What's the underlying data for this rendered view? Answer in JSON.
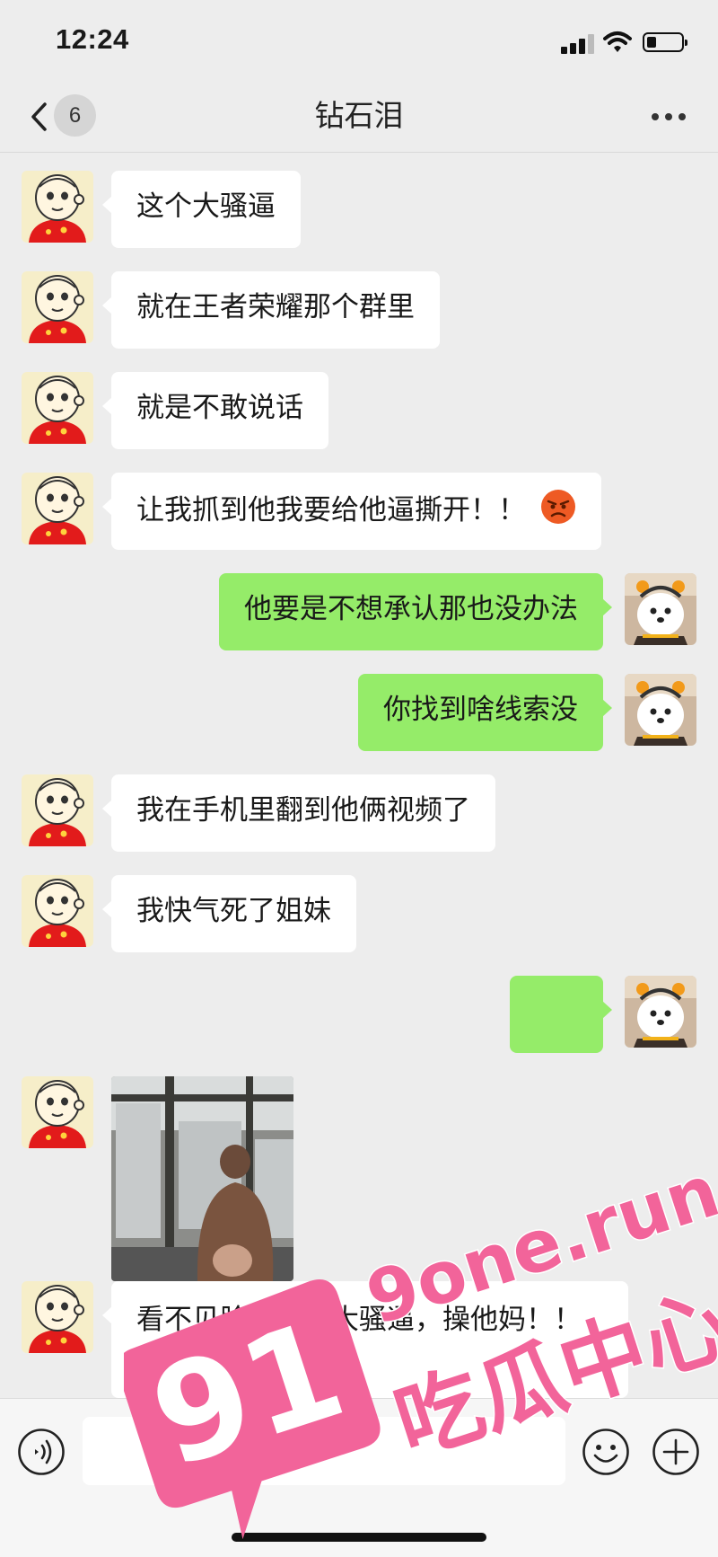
{
  "status_bar": {
    "time": "12:24",
    "icons": [
      "signal-icon",
      "wifi-icon",
      "battery-icon"
    ]
  },
  "nav": {
    "back_icon": "chevron-left-icon",
    "unread_count": "6",
    "title": "钻石泪",
    "more_icon": "more-dots-icon"
  },
  "messages": [
    {
      "side": "in",
      "text": "这个大骚逼"
    },
    {
      "side": "in",
      "text": "就在王者荣耀那个群里"
    },
    {
      "side": "in",
      "text": "就是不敢说话"
    },
    {
      "side": "in",
      "text": "让我抓到他我要给他逼撕开！！",
      "emoji": "angry-face-emoji"
    },
    {
      "side": "out",
      "text": "他要是不想承认那也没办法"
    },
    {
      "side": "out",
      "text": "你找到啥线索没"
    },
    {
      "side": "in",
      "text": "我在手机里翻到他俩视频了"
    },
    {
      "side": "in",
      "text": "我快气死了姐妹"
    },
    {
      "side": "out",
      "text": ""
    },
    {
      "side": "in",
      "type": "image"
    },
    {
      "side": "in",
      "text": "看不见脸，这个大骚逼，操他妈！！"
    }
  ],
  "input_bar": {
    "voice_icon": "voice-icon",
    "input_value": "",
    "emoji_icon": "emoji-smile-icon",
    "add_icon": "plus-circle-icon"
  },
  "watermark": {
    "number": "91",
    "domain": "9one.run",
    "label": "吃瓜中心"
  },
  "colors": {
    "background": "#ededed",
    "incoming_bubble": "#ffffff",
    "outgoing_bubble": "#95ec69",
    "watermark_pink": "#f2649a"
  }
}
